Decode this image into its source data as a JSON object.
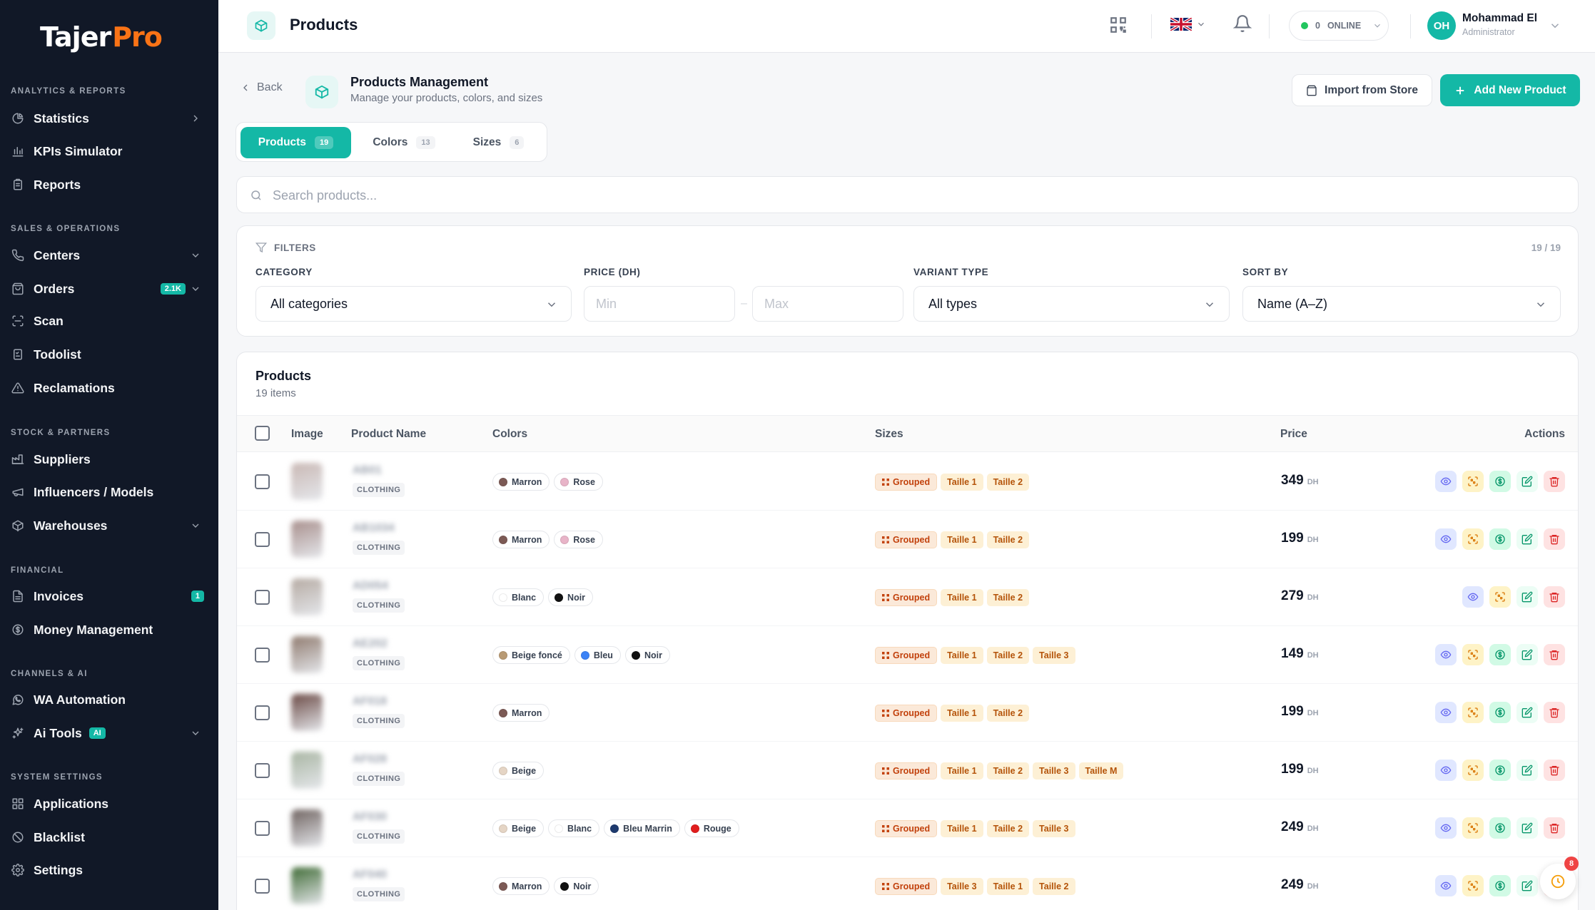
{
  "app": {
    "logo_part1": "Tajer",
    "logo_part2": "Pro"
  },
  "sidebar": {
    "sections": [
      {
        "label": "ANALYTICS & REPORTS",
        "items": [
          {
            "label": "Statistics",
            "icon": "pie-chart-icon",
            "chevron": "right"
          },
          {
            "label": "KPIs Simulator",
            "icon": "bar-chart-icon"
          },
          {
            "label": "Reports",
            "icon": "clipboard-icon"
          }
        ]
      },
      {
        "label": "SALES & OPERATIONS",
        "items": [
          {
            "label": "Centers",
            "icon": "phone-icon",
            "chevron": "down"
          },
          {
            "label": "Orders",
            "icon": "bag-icon",
            "badge": "2.1K",
            "chevron": "down"
          },
          {
            "label": "Scan",
            "icon": "scan-icon"
          },
          {
            "label": "Todolist",
            "icon": "checklist-icon"
          },
          {
            "label": "Reclamations",
            "icon": "warning-icon"
          }
        ]
      },
      {
        "label": "STOCK & PARTNERS",
        "items": [
          {
            "label": "Suppliers",
            "icon": "factory-icon"
          },
          {
            "label": "Influencers / Models",
            "icon": "megaphone-icon"
          },
          {
            "label": "Warehouses",
            "icon": "box-icon",
            "chevron": "down"
          }
        ]
      },
      {
        "label": "FINANCIAL",
        "items": [
          {
            "label": "Invoices",
            "icon": "file-icon",
            "badge": "1"
          },
          {
            "label": "Money Management",
            "icon": "dollar-circle-icon"
          }
        ]
      },
      {
        "label": "CHANNELS & AI",
        "items": [
          {
            "label": "WA Automation",
            "icon": "whatsapp-icon"
          },
          {
            "label": "Ai Tools",
            "icon": "sparkles-icon",
            "badge": "AI",
            "chevron": "down"
          }
        ]
      },
      {
        "label": "SYSTEM SETTINGS",
        "items": [
          {
            "label": "Applications",
            "icon": "grid-icon"
          },
          {
            "label": "Blacklist",
            "icon": "ban-icon"
          },
          {
            "label": "Settings",
            "icon": "settings-icon"
          }
        ]
      }
    ]
  },
  "header": {
    "title": "Products",
    "status_count": "0",
    "status_label": "ONLINE",
    "user_initials": "OH",
    "user_name": "Mohammad El",
    "user_role": "Administrator"
  },
  "page": {
    "back_label": "Back",
    "title": "Products Management",
    "subtitle": "Manage your products, colors, and sizes",
    "import_label": "Import from Store",
    "add_label": "Add New Product"
  },
  "tabs": [
    {
      "label": "Products",
      "count": "19"
    },
    {
      "label": "Colors",
      "count": "13"
    },
    {
      "label": "Sizes",
      "count": "6"
    }
  ],
  "search": {
    "placeholder": "Search products..."
  },
  "filters": {
    "title": "FILTERS",
    "count": "19 / 19",
    "category_label": "CATEGORY",
    "category_value": "All categories",
    "price_label": "PRICE (DH)",
    "min_placeholder": "Min",
    "max_placeholder": "Max",
    "variant_label": "VARIANT TYPE",
    "variant_value": "All types",
    "sort_label": "SORT BY",
    "sort_value": "Name (A–Z)"
  },
  "table": {
    "title": "Products",
    "subtitle": "19 items",
    "columns": {
      "image": "Image",
      "name": "Product Name",
      "colors": "Colors",
      "sizes": "Sizes",
      "price": "Price",
      "actions": "Actions"
    },
    "currency": "DH",
    "grouped_label": "Grouped",
    "rows": [
      {
        "name": "AB01",
        "category": "CLOTHING",
        "thumb": "#c9b8b4",
        "colors": [
          {
            "name": "Marron",
            "hex": "#7c5a55"
          },
          {
            "name": "Rose",
            "hex": "#e8b4c8"
          }
        ],
        "sizes": [
          "Taille 1",
          "Taille 2"
        ],
        "price": "349",
        "money": true
      },
      {
        "name": "AB1034",
        "category": "CLOTHING",
        "thumb": "#a88f8c",
        "colors": [
          {
            "name": "Marron",
            "hex": "#7c5a55"
          },
          {
            "name": "Rose",
            "hex": "#e8b4c8"
          }
        ],
        "sizes": [
          "Taille 1",
          "Taille 2"
        ],
        "price": "199",
        "money": true
      },
      {
        "name": "AD054",
        "category": "CLOTHING",
        "thumb": "#b5aaa2",
        "colors": [
          {
            "name": "Blanc",
            "hex": "#ffffff"
          },
          {
            "name": "Noir",
            "hex": "#111111"
          }
        ],
        "sizes": [
          "Taille 1",
          "Taille 2"
        ],
        "price": "279",
        "money": false
      },
      {
        "name": "AE202",
        "category": "CLOTHING",
        "thumb": "#8f7a6e",
        "colors": [
          {
            "name": "Beige foncé",
            "hex": "#b89a74"
          },
          {
            "name": "Bleu",
            "hex": "#3b82f6"
          },
          {
            "name": "Noir",
            "hex": "#111111"
          }
        ],
        "sizes": [
          "Taille 1",
          "Taille 2",
          "Taille 3"
        ],
        "price": "149",
        "money": true
      },
      {
        "name": "AF018",
        "category": "CLOTHING",
        "thumb": "#6b4a45",
        "colors": [
          {
            "name": "Marron",
            "hex": "#7c5a55"
          }
        ],
        "sizes": [
          "Taille 1",
          "Taille 2"
        ],
        "price": "199",
        "money": true
      },
      {
        "name": "AF028",
        "category": "CLOTHING",
        "thumb": "#a8b5a2",
        "colors": [
          {
            "name": "Beige",
            "hex": "#e5d5c5"
          }
        ],
        "sizes": [
          "Taille 1",
          "Taille 2",
          "Taille 3",
          "Taille M"
        ],
        "price": "199",
        "money": true
      },
      {
        "name": "AF030",
        "category": "CLOTHING",
        "thumb": "#6e625f",
        "colors": [
          {
            "name": "Beige",
            "hex": "#e5d5c5"
          },
          {
            "name": "Blanc",
            "hex": "#ffffff"
          },
          {
            "name": "Bleu Marrin",
            "hex": "#1e3a6e"
          },
          {
            "name": "Rouge",
            "hex": "#e11d1d"
          }
        ],
        "sizes": [
          "Taille 1",
          "Taille 2",
          "Taille 3"
        ],
        "price": "249",
        "money": true
      },
      {
        "name": "AF040",
        "category": "CLOTHING",
        "thumb": "#3f6b35",
        "colors": [
          {
            "name": "Marron",
            "hex": "#7c5a55"
          },
          {
            "name": "Noir",
            "hex": "#111111"
          }
        ],
        "sizes": [
          "Taille 3",
          "Taille 1",
          "Taille 2"
        ],
        "price": "249",
        "money": true
      }
    ]
  },
  "fab_badge": "8",
  "colors": {
    "accent": "#14b8a6",
    "sidebar": "#111827",
    "logo_orange": "#f97316"
  }
}
